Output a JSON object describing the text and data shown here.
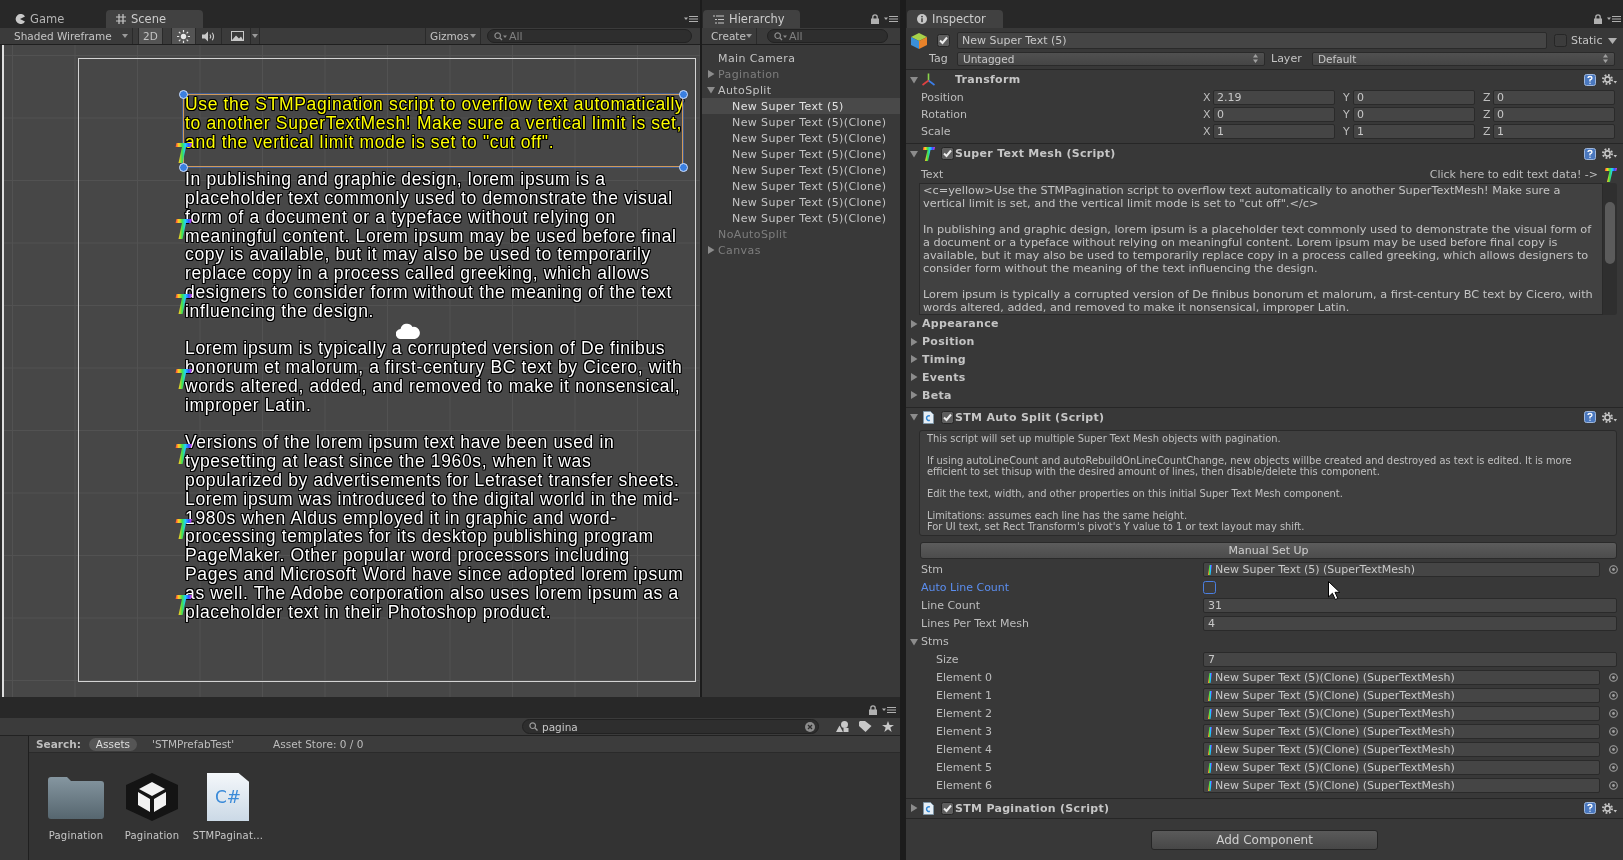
{
  "scene_panel": {
    "tabs": [
      {
        "kind": "game",
        "label": "Game",
        "selected": false
      },
      {
        "kind": "scene",
        "label": "Scene",
        "selected": true
      }
    ],
    "toolbar": {
      "shading_mode": "Shaded Wireframe",
      "toggles": [
        {
          "kind": "label",
          "label": "2D",
          "on": true
        },
        {
          "kind": "lighting",
          "on": true
        },
        {
          "kind": "audio",
          "on": false
        },
        {
          "kind": "effects",
          "on": false
        }
      ],
      "gizmos": "Gizmos",
      "search": {
        "placeholder": "All"
      }
    },
    "scene": {
      "paragraphs": [
        {
          "color": "#ffff00",
          "lines": [
            "Use the STMPagination script to overflow text automatically",
            "to another SuperTextMesh! Make sure a vertical limit is set,",
            "and the vertical limit mode is set to \"cut off\"."
          ]
        },
        {
          "color": "#ffffff",
          "lines": [
            "In publishing and graphic design, lorem ipsum is a",
            "placeholder text commonly used to demonstrate the visual",
            "form of a document or a typeface without relying on",
            "meaningful content. Lorem ipsum may be used before final",
            "copy is available, but it may also be used to temporarily",
            "replace copy in a process called greeking, which allows",
            "designers to consider form without the meaning of the text",
            "influencing the design."
          ]
        },
        {
          "color": "#ffffff",
          "lines": [
            "Lorem ipsum is typically a corrupted version of De finibus",
            "bonorum et malorum, a first-century BC text by Cicero, with",
            "words altered, added, and removed to make it nonsensical,",
            "improper Latin."
          ]
        },
        {
          "color": "#ffffff",
          "lines": [
            "Versions of the lorem ipsum text have been used in",
            "typesetting at least since the 1960s, when it was",
            "popularized by advertisements for Letraset transfer sheets.",
            "Lorem ipsum was introduced to the digital world in the mid-",
            "1980s when Aldus employed it in graphic and word-",
            "processing templates for its desktop publishing program",
            "PageMaker. Other popular word processors including",
            "Pages and Microsoft Word have since adopted lorem ipsum",
            "as well. The Adobe corporation also uses lorem ipsum as a",
            "placeholder text in their Photoshop product."
          ]
        }
      ],
      "text_objects": [
        {
          "selected": true
        },
        {
          "selected": false
        },
        {
          "selected": false
        },
        {
          "selected": false
        },
        {
          "selected": false
        },
        {
          "selected": false
        },
        {
          "selected": false
        }
      ]
    }
  },
  "hierarchy": {
    "title": "Hierarchy",
    "create": "Create",
    "search": {
      "placeholder": "All"
    },
    "items": [
      {
        "label": "Main Camera",
        "active": true,
        "selected": false
      },
      {
        "label": "Pagination",
        "active": false,
        "expanded": false,
        "selected": false
      },
      {
        "label": "AutoSplit",
        "active": true,
        "expanded": true,
        "selected": false,
        "children": [
          {
            "label": "New Super Text (5)",
            "active": true,
            "selected": true
          },
          {
            "label": "New Super Text (5)(Clone)",
            "active": true,
            "selected": false
          },
          {
            "label": "New Super Text (5)(Clone)",
            "active": true,
            "selected": false
          },
          {
            "label": "New Super Text (5)(Clone)",
            "active": true,
            "selected": false
          },
          {
            "label": "New Super Text (5)(Clone)",
            "active": true,
            "selected": false
          },
          {
            "label": "New Super Text (5)(Clone)",
            "active": true,
            "selected": false
          },
          {
            "label": "New Super Text (5)(Clone)",
            "active": true,
            "selected": false
          },
          {
            "label": "New Super Text (5)(Clone)",
            "active": true,
            "selected": false
          }
        ]
      },
      {
        "label": "NoAutoSplit",
        "active": false,
        "selected": false
      },
      {
        "label": "Canvas",
        "active": false,
        "expanded": false,
        "selected": false
      }
    ]
  },
  "inspector": {
    "title": "Inspector",
    "object": {
      "active": true,
      "name": "New Super Text (5)",
      "static_label": "Static",
      "static": false,
      "tag_label": "Tag",
      "tag": "Untagged",
      "layer_label": "Layer",
      "layer": "Default"
    },
    "components": [
      {
        "kind": "transform",
        "title": "Transform",
        "expanded": true,
        "rows": [
          {
            "label": "Position",
            "values": [
              {
                "axis": "X",
                "value": "2.19"
              },
              {
                "axis": "Y",
                "value": "0"
              },
              {
                "axis": "Z",
                "value": "0"
              }
            ]
          },
          {
            "label": "Rotation",
            "values": [
              {
                "axis": "X",
                "value": "0"
              },
              {
                "axis": "Y",
                "value": "0"
              },
              {
                "axis": "Z",
                "value": "0"
              }
            ]
          },
          {
            "label": "Scale",
            "values": [
              {
                "axis": "X",
                "value": "1"
              },
              {
                "axis": "Y",
                "value": "1"
              },
              {
                "axis": "Z",
                "value": "1"
              }
            ]
          }
        ]
      },
      {
        "kind": "text_mesh",
        "title": "Super Text Mesh (Script)",
        "enabled": true,
        "expanded": true,
        "text_label": "Text",
        "edit_hint": "Click here to edit text data! ->",
        "text": [
          "<c=yellow>Use the STMPagination script to overflow text automatically to another SuperTextMesh! Make sure a vertical limit is set, and the vertical limit mode is set to \"cut off\".</c>",
          "In publishing and graphic design, lorem ipsum is a placeholder text commonly used to demonstrate the visual form of a document or a typeface without relying on meaningful content. Lorem ipsum may be used before final copy is available, but it may also be used to temporarily replace copy in a process called greeking, which allows designers to consider form without the meaning of the text influencing the design.",
          "Lorem ipsum is typically a corrupted version of De finibus bonorum et malorum, a first-century BC text by Cicero, with words altered, added, and removed to make it nonsensical, improper Latin."
        ],
        "sections": [
          {
            "label": "Appearance",
            "expanded": false
          },
          {
            "label": "Position",
            "expanded": false
          },
          {
            "label": "Timing",
            "expanded": false
          },
          {
            "label": "Events",
            "expanded": false
          },
          {
            "label": "Beta",
            "expanded": false
          }
        ]
      },
      {
        "kind": "auto_split",
        "title": "STM Auto Split (Script)",
        "enabled": true,
        "expanded": true,
        "help": [
          {
            "lines": [
              "This script will set up multiple Super Text Mesh objects with pagination."
            ]
          },
          {
            "lines": [
              "If using autoLineCount and autoRebuildOnLineCountChange, new objects willbe created and destroyed as text is edited. It is more efficient to set thisup with the desired amount of lines, then disable/delete this component."
            ]
          },
          {
            "lines": [
              "Edit the text, width, and other properties on this initial Super Text Mesh component."
            ]
          },
          {
            "lines": [
              "Limitations: assumes each line has the same height.",
              "For UI text, set Rect Transform's pivot's Y value to 1 or text layout may shift."
            ]
          }
        ],
        "button": "Manual Set Up",
        "properties": [
          {
            "kind": "object",
            "label": "Stm",
            "value": "New Super Text (5) (SuperTextMesh)",
            "focused": false
          },
          {
            "kind": "checkbox",
            "label": "Auto Line Count",
            "checked": false,
            "focused": true
          },
          {
            "kind": "number",
            "label": "Line Count",
            "value": "31",
            "focused": false
          },
          {
            "kind": "number",
            "label": "Lines Per Text Mesh",
            "value": "4",
            "focused": false
          },
          {
            "kind": "foldout",
            "label": "Stms",
            "expanded": true,
            "focused": false,
            "children": [
              {
                "kind": "number",
                "label": "Size",
                "value": "7",
                "focused": false
              },
              {
                "kind": "object",
                "label": "Element 0",
                "value": "New Super Text (5)(Clone) (SuperTextMesh)",
                "focused": false
              },
              {
                "kind": "object",
                "label": "Element 1",
                "value": "New Super Text (5)(Clone) (SuperTextMesh)",
                "focused": false
              },
              {
                "kind": "object",
                "label": "Element 2",
                "value": "New Super Text (5)(Clone) (SuperTextMesh)",
                "focused": false
              },
              {
                "kind": "object",
                "label": "Element 3",
                "value": "New Super Text (5)(Clone) (SuperTextMesh)",
                "focused": false
              },
              {
                "kind": "object",
                "label": "Element 4",
                "value": "New Super Text (5)(Clone) (SuperTextMesh)",
                "focused": false
              },
              {
                "kind": "object",
                "label": "Element 5",
                "value": "New Super Text (5)(Clone) (SuperTextMesh)",
                "focused": false
              },
              {
                "kind": "object",
                "label": "Element 6",
                "value": "New Super Text (5)(Clone) (SuperTextMesh)",
                "focused": false
              }
            ]
          }
        ]
      },
      {
        "kind": "pagination",
        "title": "STM Pagination (Script)",
        "enabled": true,
        "expanded": false
      }
    ],
    "add_component": "Add Component"
  },
  "project": {
    "search": {
      "value": "pagina"
    },
    "scope_label": "Search:",
    "scopes": [
      {
        "label": "Assets",
        "selected": true
      },
      {
        "label": "'STMPrefabTest'",
        "selected": false
      }
    ],
    "asset_store": "Asset Store: 0 / 0",
    "assets": [
      {
        "kind": "folder",
        "name": "Pagination"
      },
      {
        "kind": "scene",
        "name": "Pagination"
      },
      {
        "kind": "script",
        "name": "STMPaginat…",
        "icon_label": "C#"
      }
    ]
  }
}
